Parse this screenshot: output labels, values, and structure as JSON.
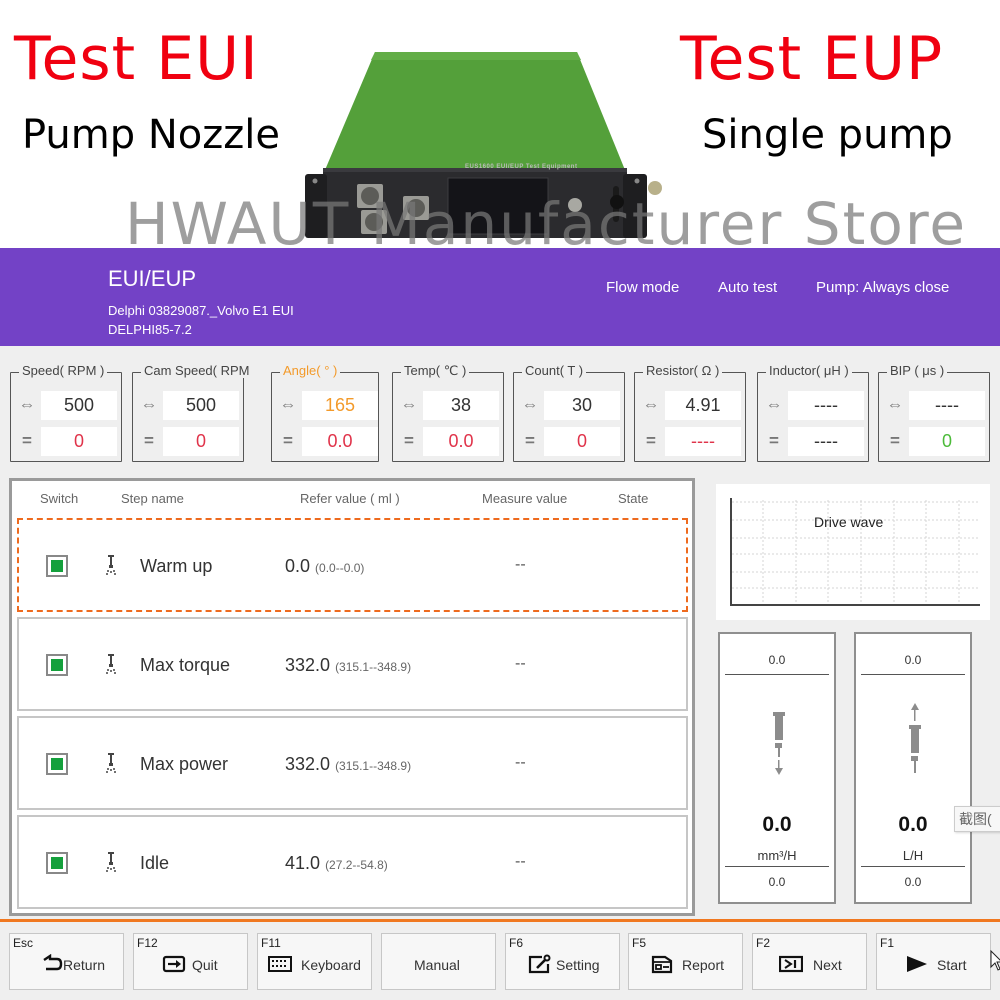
{
  "banner": {
    "left_title": "Test EUI",
    "left_subtitle": "Pump Nozzle",
    "right_title": "Test EUP",
    "right_subtitle": "Single pump",
    "device_label": "EUS1600  EUI/EUP Test Equipment",
    "watermark": "HWAUT Manufacturer Store",
    "colors": {
      "title": "#f00010",
      "device_top": "#4f9b35"
    }
  },
  "header": {
    "title": "EUI/EUP",
    "subtitle_line1": "Delphi  03829087._Volvo E1 EUI",
    "subtitle_line2": "DELPHI85-7.2",
    "links": [
      "Flow mode",
      "Auto test",
      "Pump: Always close"
    ],
    "color": "#7342c6"
  },
  "params": [
    {
      "label": "Speed( RPM )",
      "set": "500",
      "actual": "0",
      "label_color": "normal",
      "set_color": "normal",
      "actual_color": "red"
    },
    {
      "label": "Cam Speed( RPM",
      "set": "500",
      "actual": "0",
      "label_color": "normal",
      "set_color": "normal",
      "actual_color": "red"
    },
    {
      "label": "Angle( ° )",
      "set": "165",
      "actual": "0.0",
      "label_color": "orange",
      "set_color": "orange",
      "actual_color": "red"
    },
    {
      "label": "Temp( ℃ )",
      "set": "38",
      "actual": "0.0",
      "label_color": "normal",
      "set_color": "normal",
      "actual_color": "red"
    },
    {
      "label": "Count( T )",
      "set": "30",
      "actual": "0",
      "label_color": "normal",
      "set_color": "normal",
      "actual_color": "red"
    },
    {
      "label": "Resistor( Ω )",
      "set": "4.91",
      "actual": "----",
      "label_color": "normal",
      "set_color": "normal",
      "actual_color": "red"
    },
    {
      "label": "Inductor( μH )",
      "set": "----",
      "actual": "----",
      "label_color": "normal",
      "set_color": "normal",
      "actual_color": "normal"
    },
    {
      "label": "BIP ( μs )",
      "set": "----",
      "actual": "0",
      "label_color": "normal",
      "set_color": "normal",
      "actual_color": "green"
    }
  ],
  "steps_table": {
    "headers": {
      "switch": "Switch",
      "name": "Step name",
      "ref": "Refer value ( ml )",
      "measure": "Measure value",
      "state": "State"
    },
    "rows": [
      {
        "enabled": true,
        "name": "Warm up",
        "ref": "0.0",
        "range": "(0.0--0.0)",
        "measure": "--",
        "selected": true
      },
      {
        "enabled": true,
        "name": "Max torque",
        "ref": "332.0",
        "range": "(315.1--348.9)",
        "measure": "--",
        "selected": false
      },
      {
        "enabled": true,
        "name": "Max power",
        "ref": "332.0",
        "range": "(315.1--348.9)",
        "measure": "--",
        "selected": false
      },
      {
        "enabled": true,
        "name": "Idle",
        "ref": "41.0",
        "range": "(27.2--54.8)",
        "measure": "--",
        "selected": false
      }
    ]
  },
  "drive_wave": {
    "title": "Drive wave"
  },
  "gauges": [
    {
      "top": "0.0",
      "value": "0.0",
      "unit": "mm³/H",
      "bottom": "0.0",
      "icon": "injection-down-icon"
    },
    {
      "top": "0.0",
      "value": "0.0",
      "unit": "L/H",
      "bottom": "0.0",
      "icon": "return-up-icon"
    }
  ],
  "tooltip": "截图(",
  "toolbar": [
    {
      "key": "Esc",
      "label": "Return",
      "icon": "return-icon"
    },
    {
      "key": "F12",
      "label": "Quit",
      "icon": "quit-icon"
    },
    {
      "key": "F11",
      "label": "Keyboard",
      "icon": "keyboard-icon"
    },
    {
      "key": "",
      "label": "Manual",
      "icon": ""
    },
    {
      "key": "F6",
      "label": "Setting",
      "icon": "setting-icon"
    },
    {
      "key": "F5",
      "label": "Report",
      "icon": "report-icon"
    },
    {
      "key": "F2",
      "label": "Next",
      "icon": "next-icon"
    },
    {
      "key": "F1",
      "label": "Start",
      "icon": "start-icon"
    }
  ],
  "accent_colors": {
    "orange": "#f39a2a",
    "red": "#e0334a",
    "green": "#4cbb3a",
    "toolbar_line": "#f07820",
    "checkbox": "#14a03c"
  }
}
